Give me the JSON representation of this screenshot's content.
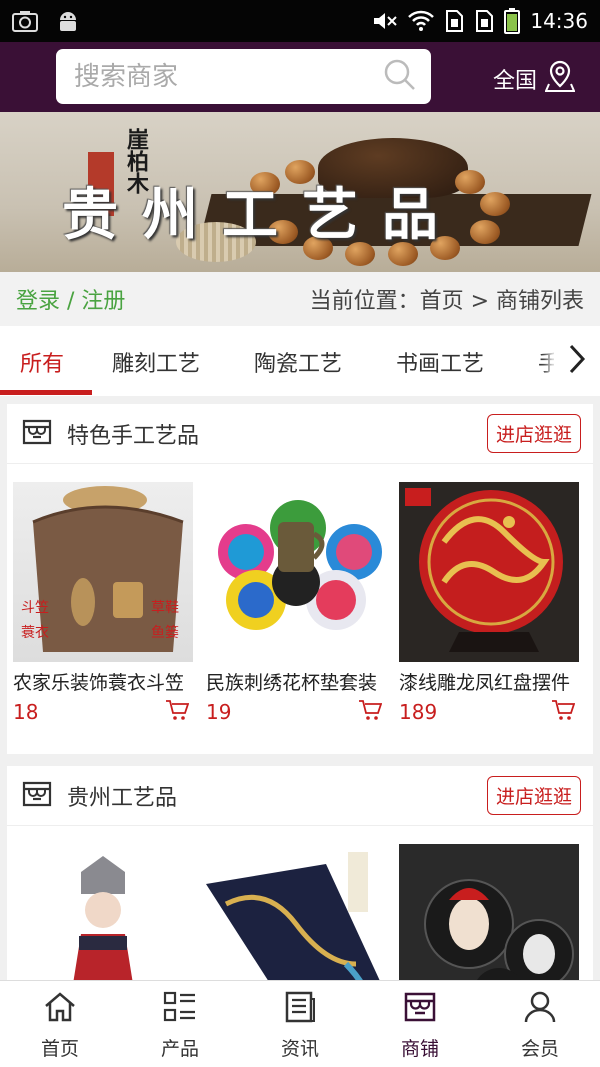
{
  "status_bar": {
    "time": "14:36"
  },
  "header": {
    "search_placeholder": "搜索商家",
    "region_label": "全国"
  },
  "banner": {
    "title": "贵州工艺品",
    "subtitle": "崖柏木"
  },
  "breadcrumb": {
    "login_register": "登录 / 注册",
    "location": "当前位置：首页 > 商铺列表"
  },
  "tabs": [
    "所有",
    "雕刻工艺",
    "陶瓷工艺",
    "书画工艺",
    "手"
  ],
  "active_tab": 0,
  "shops": [
    {
      "name": "特色手工艺品",
      "visit_label": "进店逛逛",
      "products": [
        {
          "title": "农家乐装饰蓑衣斗笠",
          "price": "18"
        },
        {
          "title": "民族刺绣花杯垫套装",
          "price": "19"
        },
        {
          "title": "漆线雕龙凤红盘摆件",
          "price": "189"
        }
      ]
    },
    {
      "name": "贵州工艺品",
      "visit_label": "进店逛逛",
      "products": [
        {
          "title": "",
          "price": ""
        },
        {
          "title": "",
          "price": ""
        },
        {
          "title": "",
          "price": ""
        }
      ]
    }
  ],
  "bottom_nav": [
    {
      "label": "首页",
      "icon": "home-icon"
    },
    {
      "label": "产品",
      "icon": "grid-list-icon"
    },
    {
      "label": "资讯",
      "icon": "news-icon"
    },
    {
      "label": "商铺",
      "icon": "store-icon"
    },
    {
      "label": "会员",
      "icon": "user-icon"
    }
  ],
  "colors": {
    "header_bg": "#3a1036",
    "accent_red": "#c81e1e",
    "login_green": "#4aa341"
  }
}
